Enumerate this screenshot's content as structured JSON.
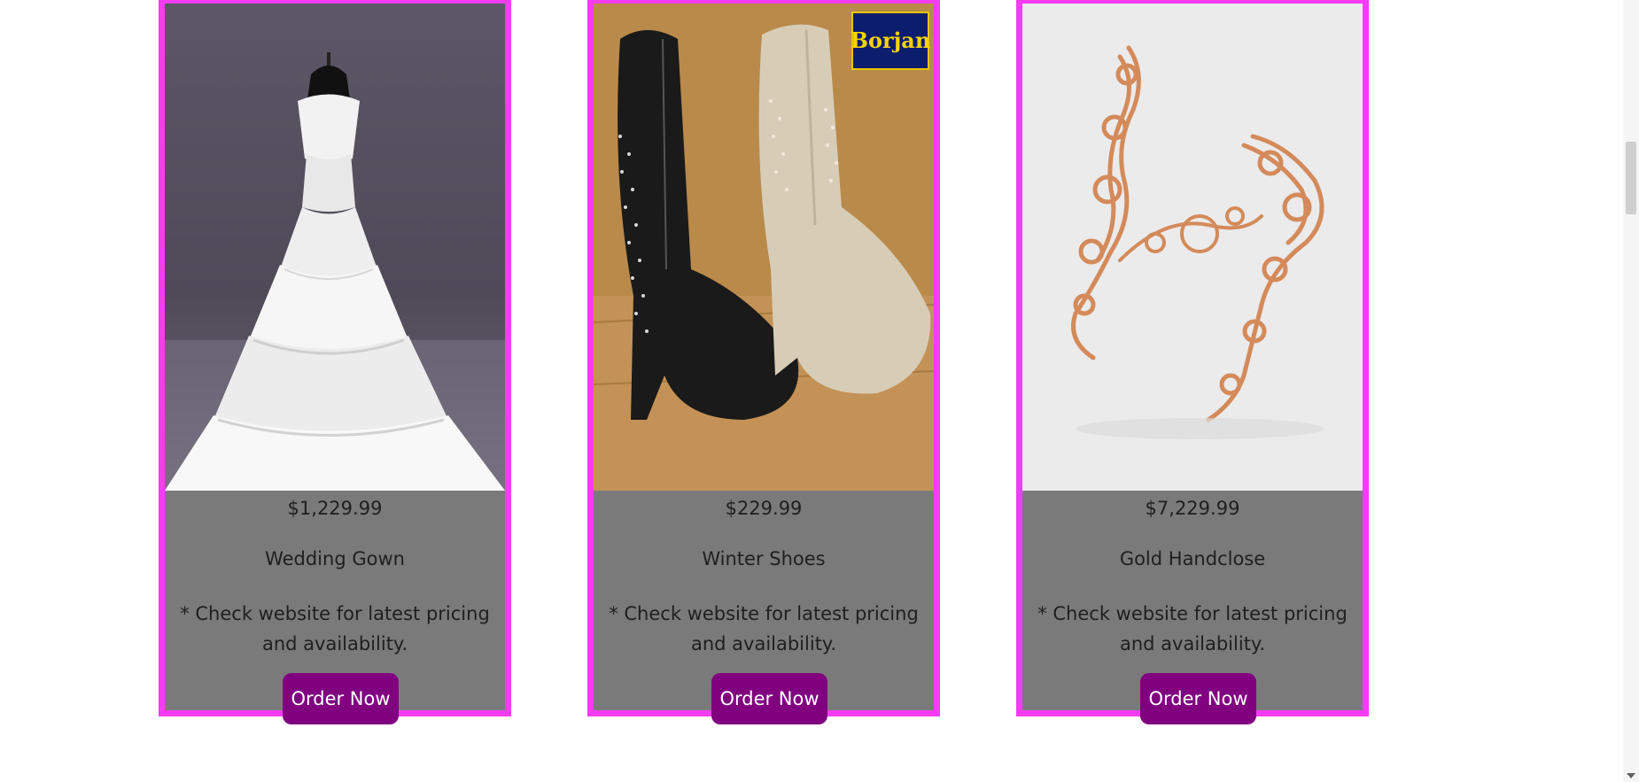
{
  "products": [
    {
      "price": "$1,229.99",
      "name": "Wedding Gown",
      "note": "* Check website for latest pricing and availability.",
      "button_label": "Order Now",
      "image": "wedding-gown-photo"
    },
    {
      "price": "$229.99",
      "name": "Winter Shoes",
      "note": "* Check website for latest pricing and availability.",
      "button_label": "Order Now",
      "image": "winter-shoes-photo",
      "logo_text": "Borjan"
    },
    {
      "price": "$7,229.99",
      "name": "Gold Handclose",
      "note": "* Check website for latest pricing and availability.",
      "button_label": "Order Now",
      "image": "gold-handclose-photo"
    }
  ],
  "colors": {
    "card_border": "#f43cf4",
    "card_background": "#7a7a7a",
    "button_background": "#800080",
    "button_text": "#ffffff"
  }
}
